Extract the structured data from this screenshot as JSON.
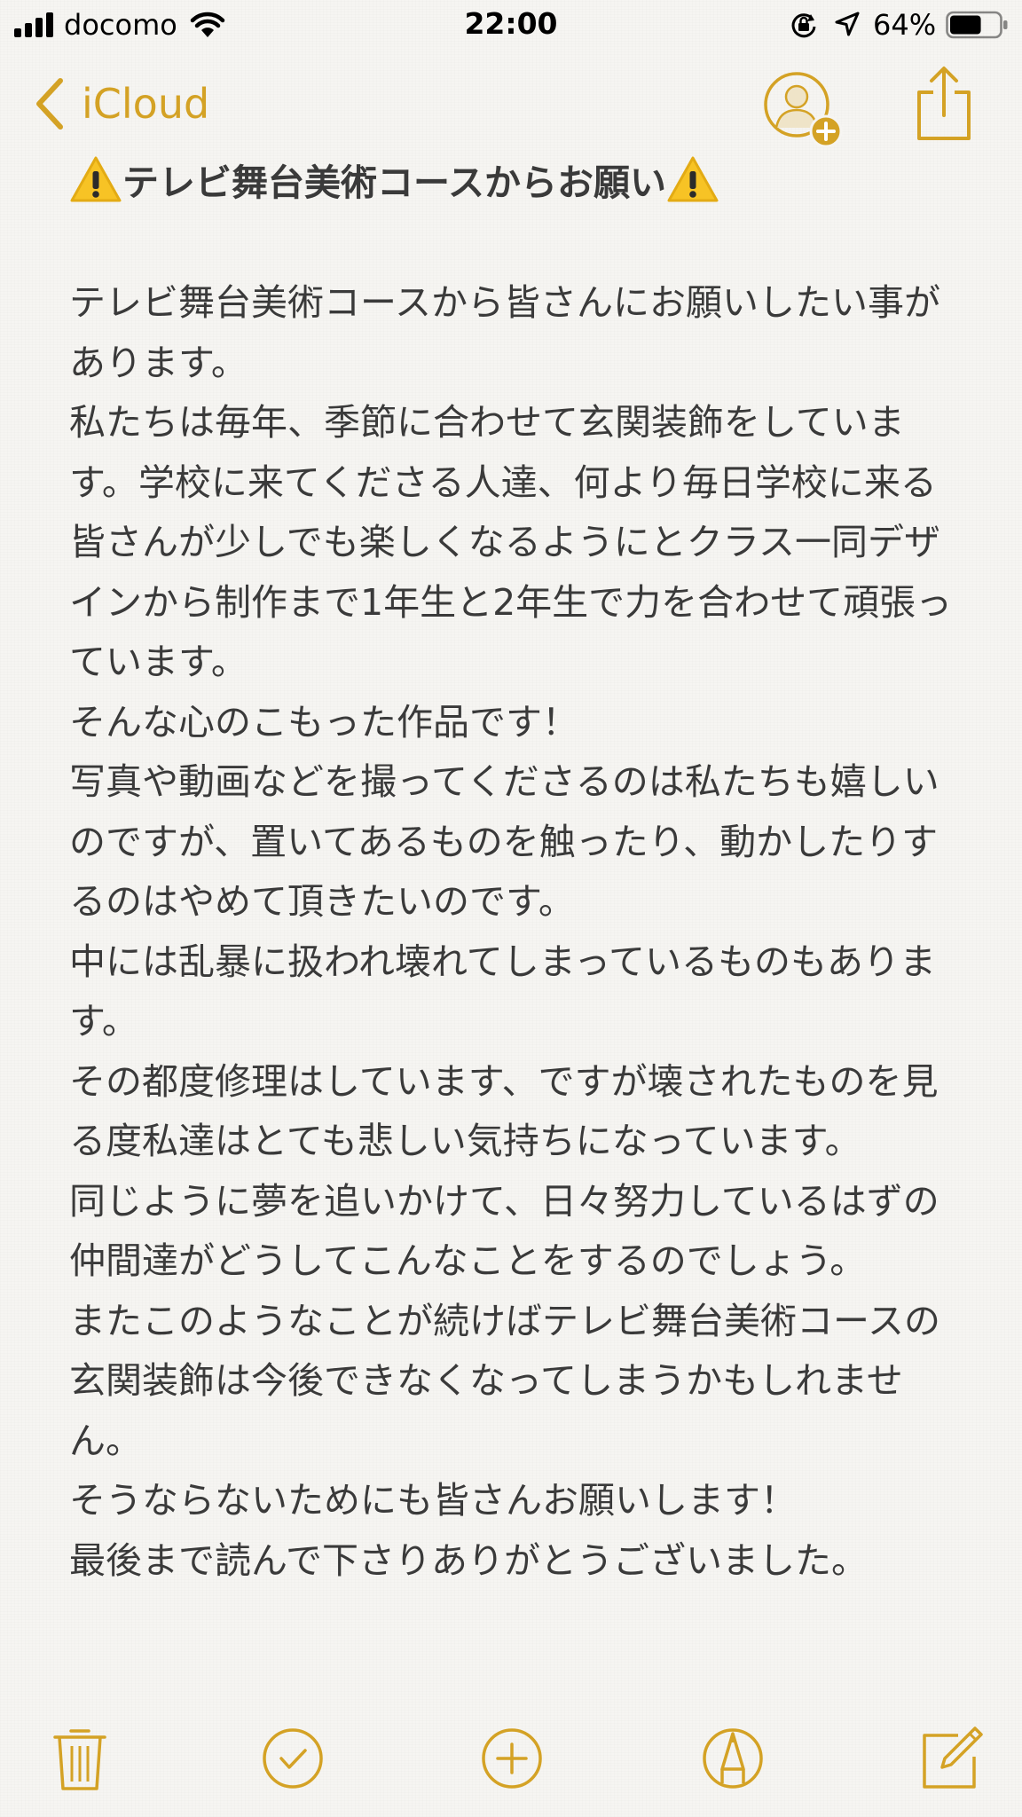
{
  "status_bar": {
    "carrier": "docomo",
    "time": "22:00",
    "battery_percent": "64%",
    "battery_level": 0.64
  },
  "nav": {
    "back_label": "iCloud",
    "icons": [
      "chevron-left-icon",
      "add-person-icon",
      "share-icon"
    ]
  },
  "note": {
    "title": "テレビ舞台美術コースからお願い",
    "body": "テレビ舞台美術コースから皆さんにお願いしたい事があります。\n私たちは毎年、季節に合わせて玄関装飾をしています。学校に来てくださる人達、何より毎日学校に来る皆さんが少しでも楽しくなるようにとクラス一同デザインから制作まで1年生と2年生で力を合わせて頑張っています。\nそんな心のこもった作品です！\n写真や動画などを撮ってくださるのは私たちも嬉しいのですが、置いてあるものを触ったり、動かしたりするのはやめて頂きたいのです。\n中には乱暴に扱われ壊れてしまっているものもあります。\nその都度修理はしています、ですが壊されたものを見る度私達はとても悲しい気持ちになっています。\n同じように夢を追いかけて、日々努力しているはずの仲間達がどうしてこんなことをするのでしょう。\nまたこのようなことが続けばテレビ舞台美術コースの玄関装飾は今後できなくなってしまうかもしれません。\nそうならないためにも皆さんお願いします！\n最後まで読んで下さりありがとうございました。"
  },
  "toolbar": {
    "icons": [
      "trash-icon",
      "checklist-icon",
      "add-icon",
      "markup-icon",
      "compose-icon"
    ]
  },
  "colors": {
    "accent": "#d4a225",
    "text": "#3a3a3a",
    "background": "#f6f5f2",
    "warning_yellow": "#f7c325"
  }
}
